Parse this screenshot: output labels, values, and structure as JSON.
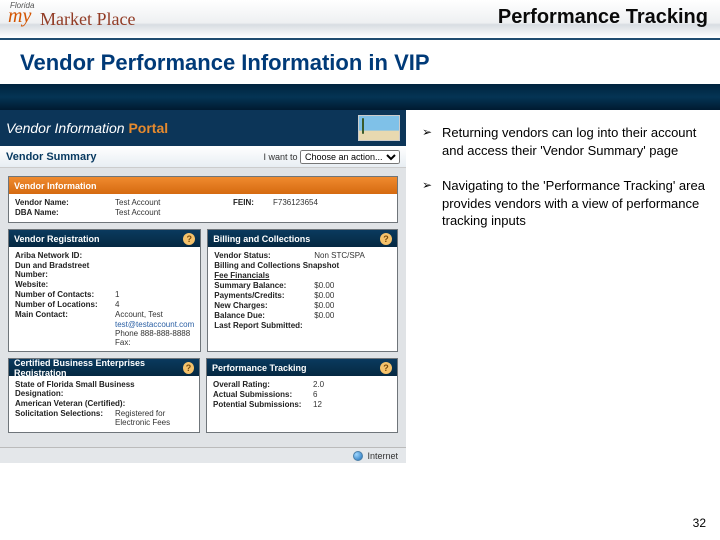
{
  "header": {
    "logo_prefix_small": "Florida",
    "logo_prefix": "my",
    "logo_text": "Market Place",
    "title": "Performance Tracking"
  },
  "slide_title": "Vendor Performance Information in VIP",
  "bullets": [
    "Returning vendors can log into their account and access their 'Vendor Summary' page",
    "Navigating to the 'Performance Tracking' area provides vendors with a view of performance tracking inputs"
  ],
  "page_number": "32",
  "vip": {
    "banner_left": "Vendor Information",
    "banner_right": "Portal",
    "sub_header": "Vendor Summary",
    "dropdown_label": "I want to",
    "dropdown_value": "Choose an action...",
    "vendor_info": {
      "title": "Vendor Information",
      "vendor_name_lbl": "Vendor Name:",
      "vendor_name_val": "Test Account",
      "fein_lbl": "FEIN:",
      "fein_val": "F736123654",
      "dba_lbl": "DBA Name:",
      "dba_val": "Test Account"
    },
    "vendor_reg": {
      "title": "Vendor Registration",
      "rows": [
        {
          "lbl": "Ariba Network ID:",
          "val": ""
        },
        {
          "lbl": "Dun and Bradstreet Number:",
          "val": ""
        },
        {
          "lbl": "Website:",
          "val": ""
        },
        {
          "lbl": "Number of Contacts:",
          "val": "1"
        },
        {
          "lbl": "Number of Locations:",
          "val": "4"
        },
        {
          "lbl": "Main Contact:",
          "val": "Account, Test"
        }
      ],
      "contact_extra": [
        "test@testaccount.com",
        "Phone 888-888-8888",
        "Fax:"
      ]
    },
    "billing": {
      "title": "Billing and Collections",
      "rows": [
        {
          "lbl": "Vendor Status:",
          "val": "Non STC/SPA"
        },
        {
          "lbl": "Billing and Collections Snapshot",
          "val": ""
        },
        {
          "lbl": "Fee Financials",
          "val": ""
        },
        {
          "lbl": "Summary Balance:",
          "val": "$0.00"
        },
        {
          "lbl": "Payments/Credits:",
          "val": "$0.00"
        },
        {
          "lbl": "New Charges:",
          "val": "$0.00"
        },
        {
          "lbl": "Balance Due:",
          "val": "$0.00"
        },
        {
          "lbl": "Last Report Submitted:",
          "val": ""
        }
      ]
    },
    "cbe": {
      "title": "Certified Business Enterprises Registration",
      "rows": [
        {
          "lbl": "State of Florida Small Business Designation:",
          "val": ""
        },
        {
          "lbl": "American Veteran (Certified):",
          "val": ""
        },
        {
          "lbl": "Solicitation Selections:",
          "val": "Registered for Electronic Fees"
        }
      ]
    },
    "perf": {
      "title": "Performance Tracking",
      "rows": [
        {
          "lbl": "Overall Rating:",
          "val": "2.0"
        },
        {
          "lbl": "Actual Submissions:",
          "val": "6"
        },
        {
          "lbl": "Potential Submissions:",
          "val": "12"
        }
      ]
    },
    "status_text": "Internet"
  }
}
